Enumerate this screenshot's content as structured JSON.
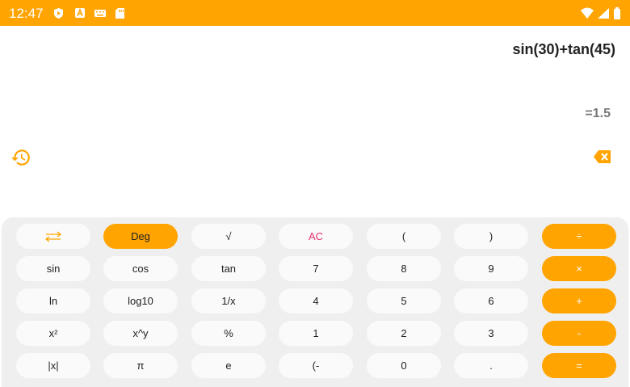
{
  "status_bar": {
    "time": "12:47",
    "left_icons": [
      "play-protect-icon",
      "a-badge-icon",
      "keyboard-icon",
      "sd-card-icon"
    ],
    "right_icons": [
      "wifi-icon",
      "signal-icon",
      "battery-icon"
    ],
    "color": "#ffa400"
  },
  "display": {
    "expression": "sin(30)+tan(45)",
    "result": "=1.5"
  },
  "accent_color": "#ffa400",
  "keypad": {
    "rows": [
      [
        "⇄",
        "Deg",
        "√",
        "AC",
        "(",
        ")",
        "÷"
      ],
      [
        "sin",
        "cos",
        "tan",
        "7",
        "8",
        "9",
        "×"
      ],
      [
        "ln",
        "log10",
        "1/x",
        "4",
        "5",
        "6",
        "+"
      ],
      [
        "x²",
        "x^y",
        "%",
        "1",
        "2",
        "3",
        "-"
      ],
      [
        "|x|",
        "π",
        "e",
        "(-",
        "0",
        ".",
        "="
      ]
    ]
  }
}
